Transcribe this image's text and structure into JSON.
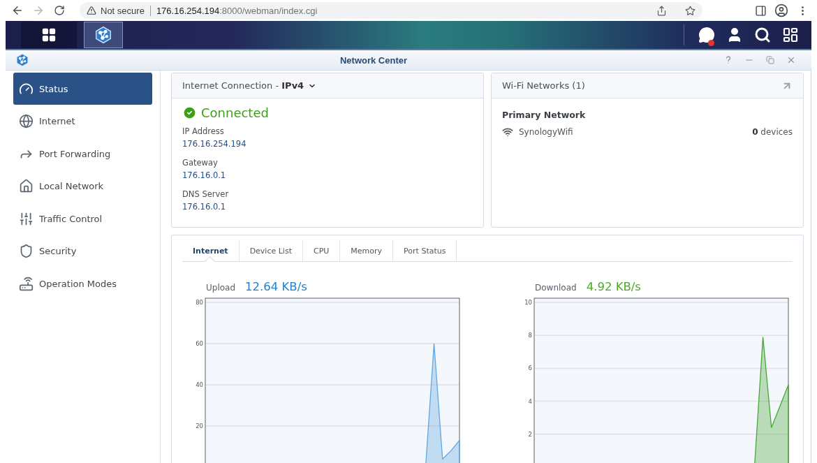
{
  "browser": {
    "security": "Not secure",
    "url_host": "176.16.254.194",
    "url_rest": ":8000/webman/index.cgi",
    "forward_disabled": true
  },
  "taskbar": {
    "buttons": [
      {
        "kind": "main-menu",
        "selected": false
      },
      {
        "kind": "network-center",
        "selected": true
      }
    ],
    "notification_unread": true
  },
  "window": {
    "title": "Network Center"
  },
  "sidebar": {
    "items": [
      {
        "label": "Status",
        "selected": true
      },
      {
        "label": "Internet",
        "selected": false
      },
      {
        "label": "Port Forwarding",
        "selected": false
      },
      {
        "label": "Local Network",
        "selected": false
      },
      {
        "label": "Traffic Control",
        "selected": false
      },
      {
        "label": "Security",
        "selected": false
      },
      {
        "label": "Operation Modes",
        "selected": false
      }
    ]
  },
  "connection": {
    "title": "Internet Connection - **IPv4**",
    "status": "Connected",
    "fields": [
      {
        "label": "IP Address",
        "value": "176.16.254.194"
      },
      {
        "label": "Gateway",
        "value": "176.16.0.1"
      },
      {
        "label": "DNS Server",
        "value": "176.16.0.1"
      }
    ]
  },
  "wifi": {
    "title": "Wi-Fi Networks (1)",
    "section": "Primary Network",
    "networks": [
      {
        "name": "SynologyWifi",
        "devices": "**0** devices"
      }
    ]
  },
  "tabs": [
    {
      "label": "Internet",
      "selected": true
    },
    {
      "label": "Device List",
      "selected": false
    },
    {
      "label": "CPU",
      "selected": false
    },
    {
      "label": "Memory",
      "selected": false
    },
    {
      "label": "Port Status",
      "selected": false
    }
  ],
  "charts": [
    {
      "label": "Upload",
      "reading": "12.64 KB/s",
      "color": "#1f7fd0",
      "chart_data": {
        "type": "area",
        "ylim": [
          0,
          80
        ],
        "yticks": [
          20,
          40,
          60,
          80
        ],
        "grid": true,
        "series": [
          {
            "color": "#62a6e2",
            "values": [
              0,
              0,
              0,
              0,
              0,
              0,
              0,
              0,
              0,
              0,
              0,
              0,
              0,
              0,
              0,
              0,
              0,
              0,
              0,
              0,
              0,
              0,
              0,
              0,
              0,
              0,
              0,
              60,
              4,
              8,
              13
            ]
          }
        ]
      }
    },
    {
      "label": "Download",
      "reading": "4.92 KB/s",
      "color": "#4fa82a",
      "chart_data": {
        "type": "area",
        "ylim": [
          0,
          10
        ],
        "yticks": [
          2,
          4,
          6,
          8,
          10
        ],
        "grid": true,
        "series": [
          {
            "color": "#4aa73a",
            "values": [
              0,
              0,
              0,
              0,
              0,
              0,
              0,
              0,
              0,
              0,
              0,
              0,
              0,
              0,
              0,
              0,
              0,
              0,
              0,
              0,
              0,
              0,
              0,
              0,
              0,
              0,
              0,
              7.9,
              2.4,
              3.7,
              5
            ]
          }
        ]
      }
    }
  ]
}
